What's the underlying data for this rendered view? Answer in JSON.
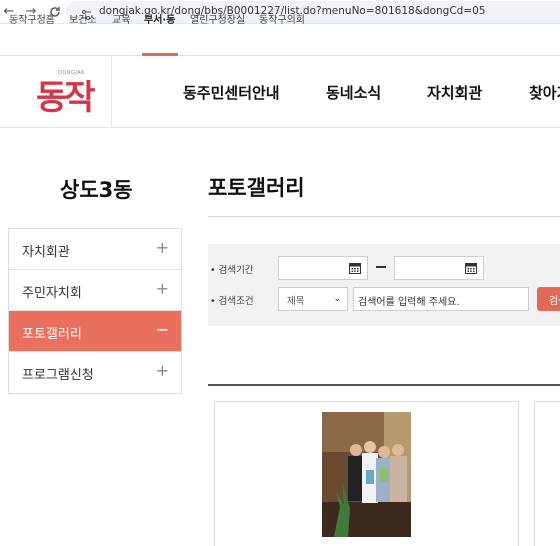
{
  "browser": {
    "url": "dongjak.go.kr/dong/bbs/B0001227/list.do?menuNo=801618&dongCd=05",
    "back_icon": "arrow-left-icon",
    "forward_icon": "arrow-right-icon",
    "reload_icon": "reload-icon",
    "site_info_icon": "site-info-icon"
  },
  "gnb": {
    "items": [
      "동작구청홈",
      "보건소",
      "교육",
      "부서·동",
      "열린구청장실",
      "동작구의회"
    ],
    "active_index": 3
  },
  "header": {
    "logo_en": "DONGJAK",
    "logo_ko": "동작",
    "menu": [
      "동주민센터안내",
      "동네소식",
      "자치회관",
      "찾아가"
    ]
  },
  "sidebar": {
    "title": "상도3동",
    "items": [
      {
        "label": "자치회관",
        "sign": "+"
      },
      {
        "label": "주민자치회",
        "sign": "+"
      },
      {
        "label": "포토갤러리",
        "sign": "−"
      },
      {
        "label": "프로그램신청",
        "sign": "+"
      }
    ],
    "active_index": 2
  },
  "content": {
    "page_title": "포토갤러리",
    "search": {
      "period_label": "• 검색기간",
      "condition_label": "• 검색조건",
      "start_date": "",
      "end_date": "",
      "field_select": "제목",
      "keyword_placeholder": "검색어를 입력해 주세요.",
      "search_button": "검색"
    }
  },
  "colors": {
    "accent": "#e9705e",
    "logo_red": "#d63447"
  }
}
